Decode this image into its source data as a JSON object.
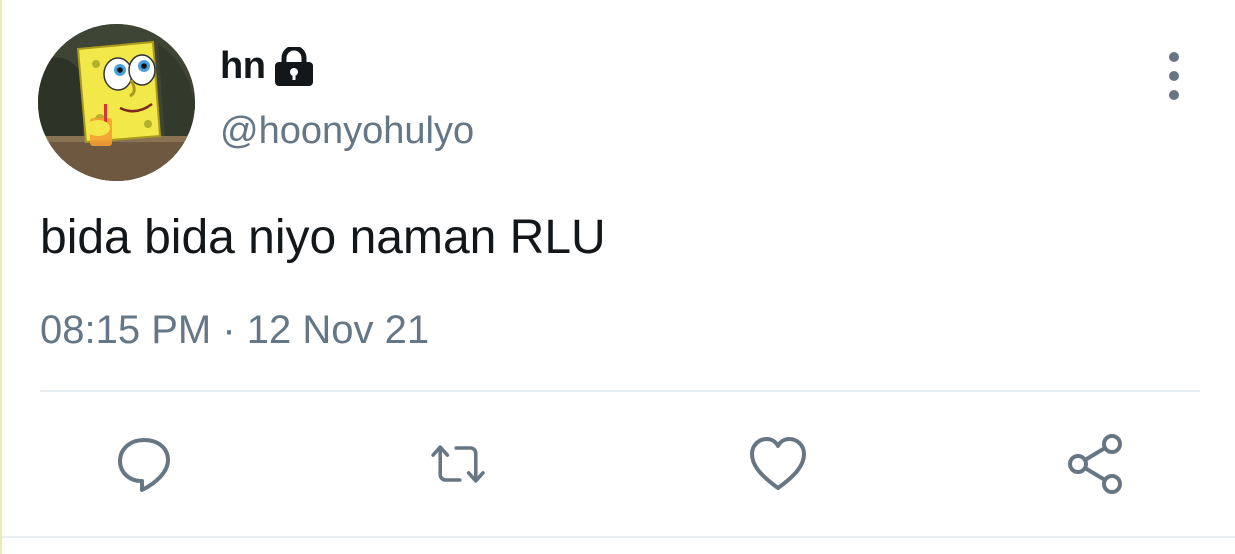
{
  "tweet": {
    "author": {
      "display_name": "hn",
      "handle": "@hoonyohulyo",
      "protected_icon": "lock-icon",
      "avatar": "spongebob-avatar"
    },
    "text": "bida bida niyo naman RLU",
    "timestamp": "08:15 PM · 12 Nov 21"
  },
  "actions": [
    {
      "name": "reply",
      "icon": "reply-icon"
    },
    {
      "name": "retweet",
      "icon": "retweet-icon"
    },
    {
      "name": "like",
      "icon": "heart-icon"
    },
    {
      "name": "share",
      "icon": "share-icon"
    }
  ],
  "menu": {
    "icon": "more-vertical-icon"
  },
  "colors": {
    "text_primary": "#14171a",
    "text_secondary": "#657786",
    "icon": "#687684",
    "divider": "#e6ecf0"
  }
}
